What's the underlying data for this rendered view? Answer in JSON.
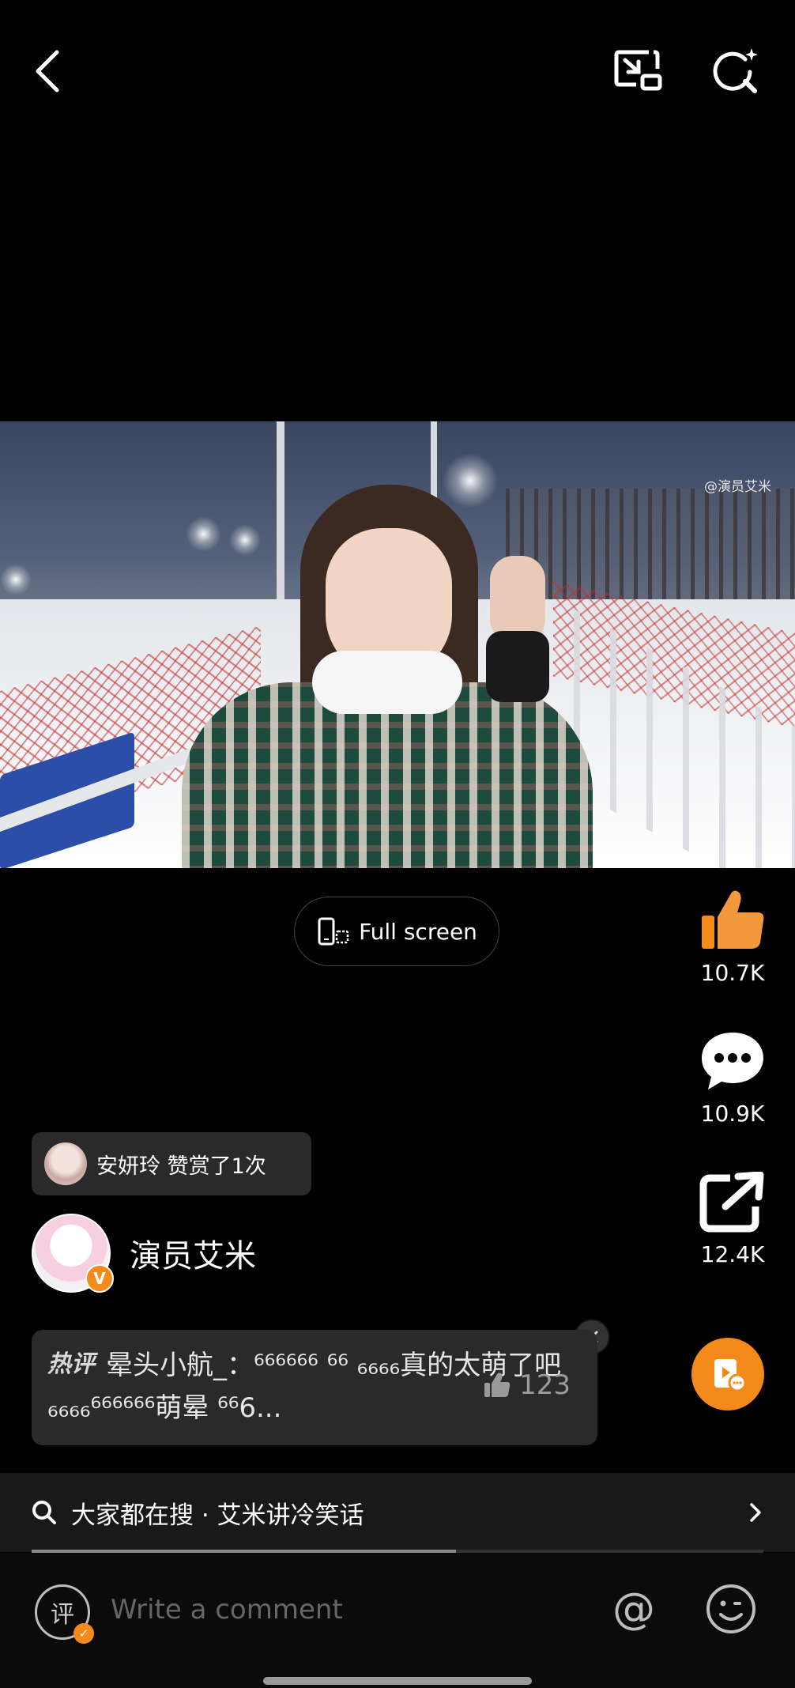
{
  "video": {
    "watermark": "@演员艾米"
  },
  "player": {
    "fullscreen_label": "Full screen"
  },
  "actions": {
    "likes": "10.7K",
    "comments": "10.9K",
    "shares": "12.4K"
  },
  "gift": {
    "text": "安妍玲 赞赏了1次"
  },
  "author": {
    "name": "演员艾米",
    "badge": "V"
  },
  "hot_comment": {
    "tag": "热评",
    "text": "晕头小航_：⁶⁶⁶⁶⁶⁶ ⁶⁶ ₆₆₆₆真的太萌了吧₆₆₆₆⁶⁶⁶⁶⁶⁶萌晕 ⁶⁶6...",
    "likes": "123"
  },
  "search": {
    "text": "大家都在搜 · 艾米讲冷笑话",
    "progress": 0.58
  },
  "comment_bar": {
    "icon_char": "评",
    "placeholder": "Write a comment",
    "at": "@"
  },
  "colors": {
    "accent": "#f38a1a",
    "background": "#000000",
    "panel": "#2a2a2a"
  },
  "icons": [
    "back-icon",
    "pip-icon",
    "ai-search-icon",
    "phone-rotate-icon",
    "thumbs-up-icon",
    "chat-bubble-icon",
    "share-icon",
    "publish-icon",
    "close-icon",
    "search-icon",
    "chevron-right-icon",
    "at-icon",
    "emoji-icon"
  ]
}
